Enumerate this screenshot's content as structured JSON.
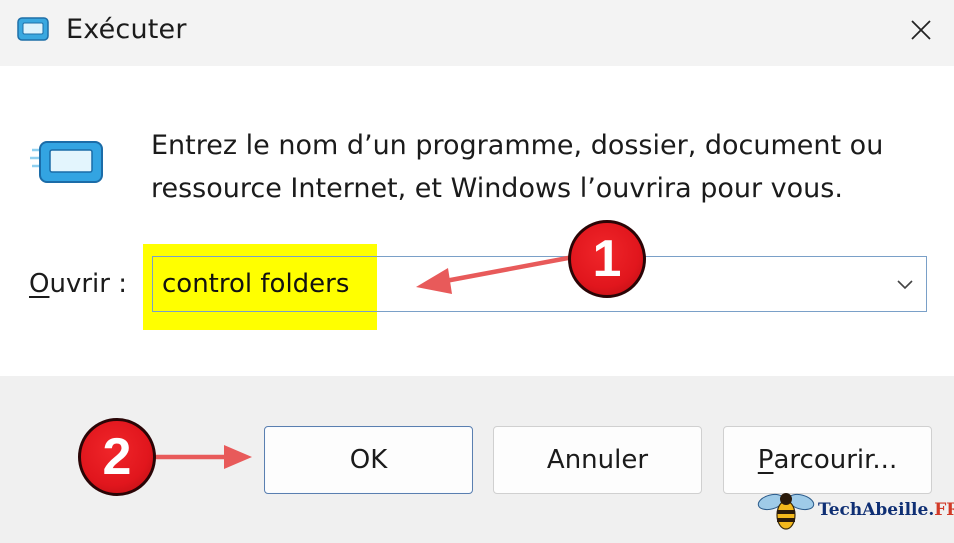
{
  "window": {
    "title": "Exécuter",
    "close_symbol": "×"
  },
  "description": {
    "line1": "Entrez le nom d’un programme, dossier, document ou",
    "line2": "ressource Internet, et Windows l’ouvrira pour vous."
  },
  "open_field": {
    "label_accel": "O",
    "label_rest": "uvrir :",
    "value": "control folders"
  },
  "buttons": {
    "ok": "OK",
    "cancel": "Annuler",
    "browse_accel": "P",
    "browse_rest": "arcourir..."
  },
  "annotations": {
    "step1": "1",
    "step2": "2",
    "highlight_color": "#ffff00",
    "badge_color": "#e1161d",
    "arrow_color": "#e85a5a"
  },
  "watermark": {
    "brand_main": "TechAbeille",
    "brand_dot": ".",
    "brand_tld": "FR"
  },
  "icons": [
    "run-app-icon",
    "close-icon",
    "chevron-down-icon",
    "bee-logo"
  ]
}
